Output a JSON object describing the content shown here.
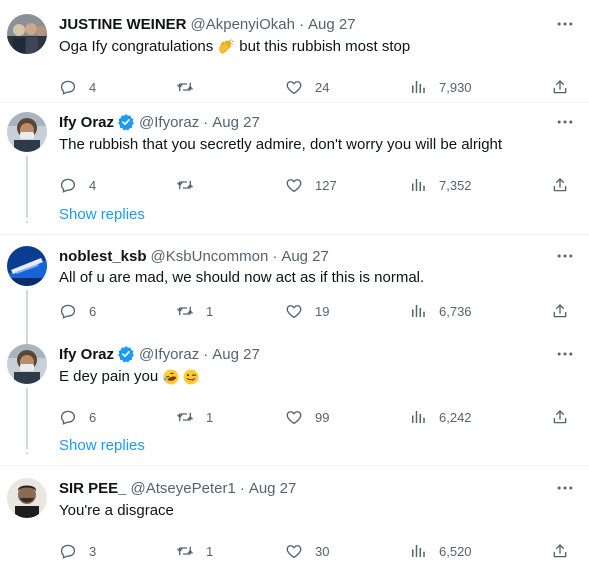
{
  "tweets": [
    {
      "name": "JUSTINE WEINER",
      "handle": "@AkpenyiOkah",
      "sep": "·",
      "date": "Aug 27",
      "text": "Oga Ify congratulations",
      "text_after": "but this rubbish most stop",
      "emoji": "clapping-hands",
      "replies": "4",
      "retweets": "",
      "likes": "24",
      "views": "7,930"
    },
    {
      "name": "Ify Oraz",
      "handle": "@Ifyoraz",
      "sep": "·",
      "date": "Aug 27",
      "verified": true,
      "text": "The rubbish that you secretly admire, don't worry you will be alright",
      "replies": "4",
      "retweets": "",
      "likes": "127",
      "views": "7,352"
    },
    {
      "name": "noblest_ksb",
      "handle": "@KsbUncommon",
      "sep": "·",
      "date": "Aug 27",
      "text": "All of u are mad, we should now act as if this is normal.",
      "replies": "6",
      "retweets": "1",
      "likes": "19",
      "views": "6,736"
    },
    {
      "name": "Ify Oraz",
      "handle": "@Ifyoraz",
      "sep": "·",
      "date": "Aug 27",
      "verified": true,
      "text": "E dey pain you",
      "emoji": "rofl, winking-tongue",
      "replies": "6",
      "retweets": "1",
      "likes": "99",
      "views": "6,242"
    },
    {
      "name": "SIR PEE_",
      "handle": "@AtseyePeter1",
      "sep": "·",
      "date": "Aug 27",
      "text": "You're a disgrace",
      "replies": "3",
      "retweets": "1",
      "likes": "30",
      "views": "6,520"
    }
  ],
  "show_replies_label": "Show replies",
  "colors": {
    "accent": "#1d9bf0",
    "muted": "#536471",
    "text": "#0f1419",
    "divider": "#eff3f4"
  }
}
